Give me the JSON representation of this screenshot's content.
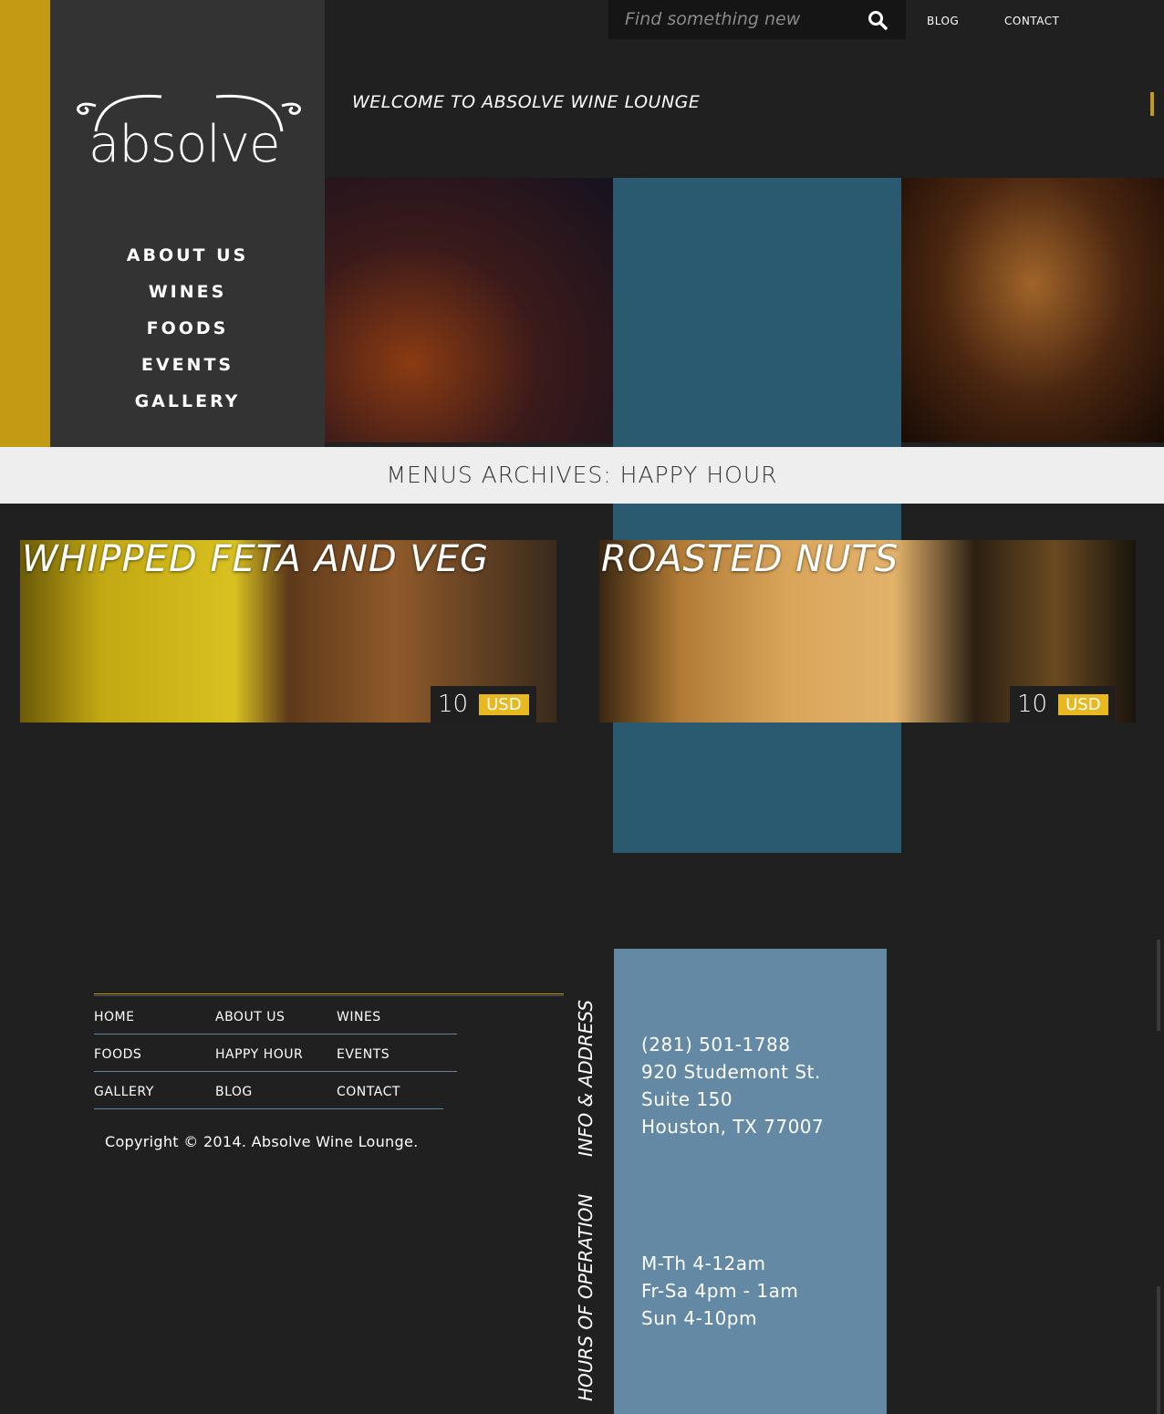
{
  "brand": {
    "logo_text": "absolve"
  },
  "search": {
    "placeholder": "Find something new"
  },
  "top_nav": {
    "blog": "BLOG",
    "contact": "CONTACT"
  },
  "welcome": "WELCOME TO ABSOLVE WINE LOUNGE",
  "main_nav": [
    "ABOUT US",
    "WINES",
    "FOODS",
    "EVENTS",
    "GALLERY"
  ],
  "archive_title": "MENUS ARCHIVES: HAPPY HOUR",
  "menu_items": [
    {
      "title": "WHIPPED FETA AND VEG",
      "price": "10",
      "currency": "USD"
    },
    {
      "title": "ROASTED NUTS",
      "price": "10",
      "currency": "USD"
    }
  ],
  "footer": {
    "links": [
      "HOME",
      "ABOUT US",
      "WINES",
      "FOODS",
      "HAPPY HOUR",
      "EVENTS",
      "GALLERY",
      "BLOG",
      "CONTACT"
    ],
    "copyright": "Copyright © 2014. Absolve Wine Lounge."
  },
  "info": {
    "heading": "INFO & ADDRESS",
    "lines": [
      "(281) 501-1788",
      "920 Studemont St.",
      "Suite 150",
      "Houston, TX 77007"
    ]
  },
  "hours": {
    "heading": "HOURS OF OPERATION",
    "lines": [
      "M-Th 4-12am",
      "Fr-Sa 4pm - 1am",
      "Sun 4-10pm"
    ]
  },
  "colors": {
    "gold": "#c39a14",
    "sidebar": "#333333",
    "teal": "#2a5a70",
    "info_panel": "#6489a5",
    "price_tag": "#e8b820"
  }
}
